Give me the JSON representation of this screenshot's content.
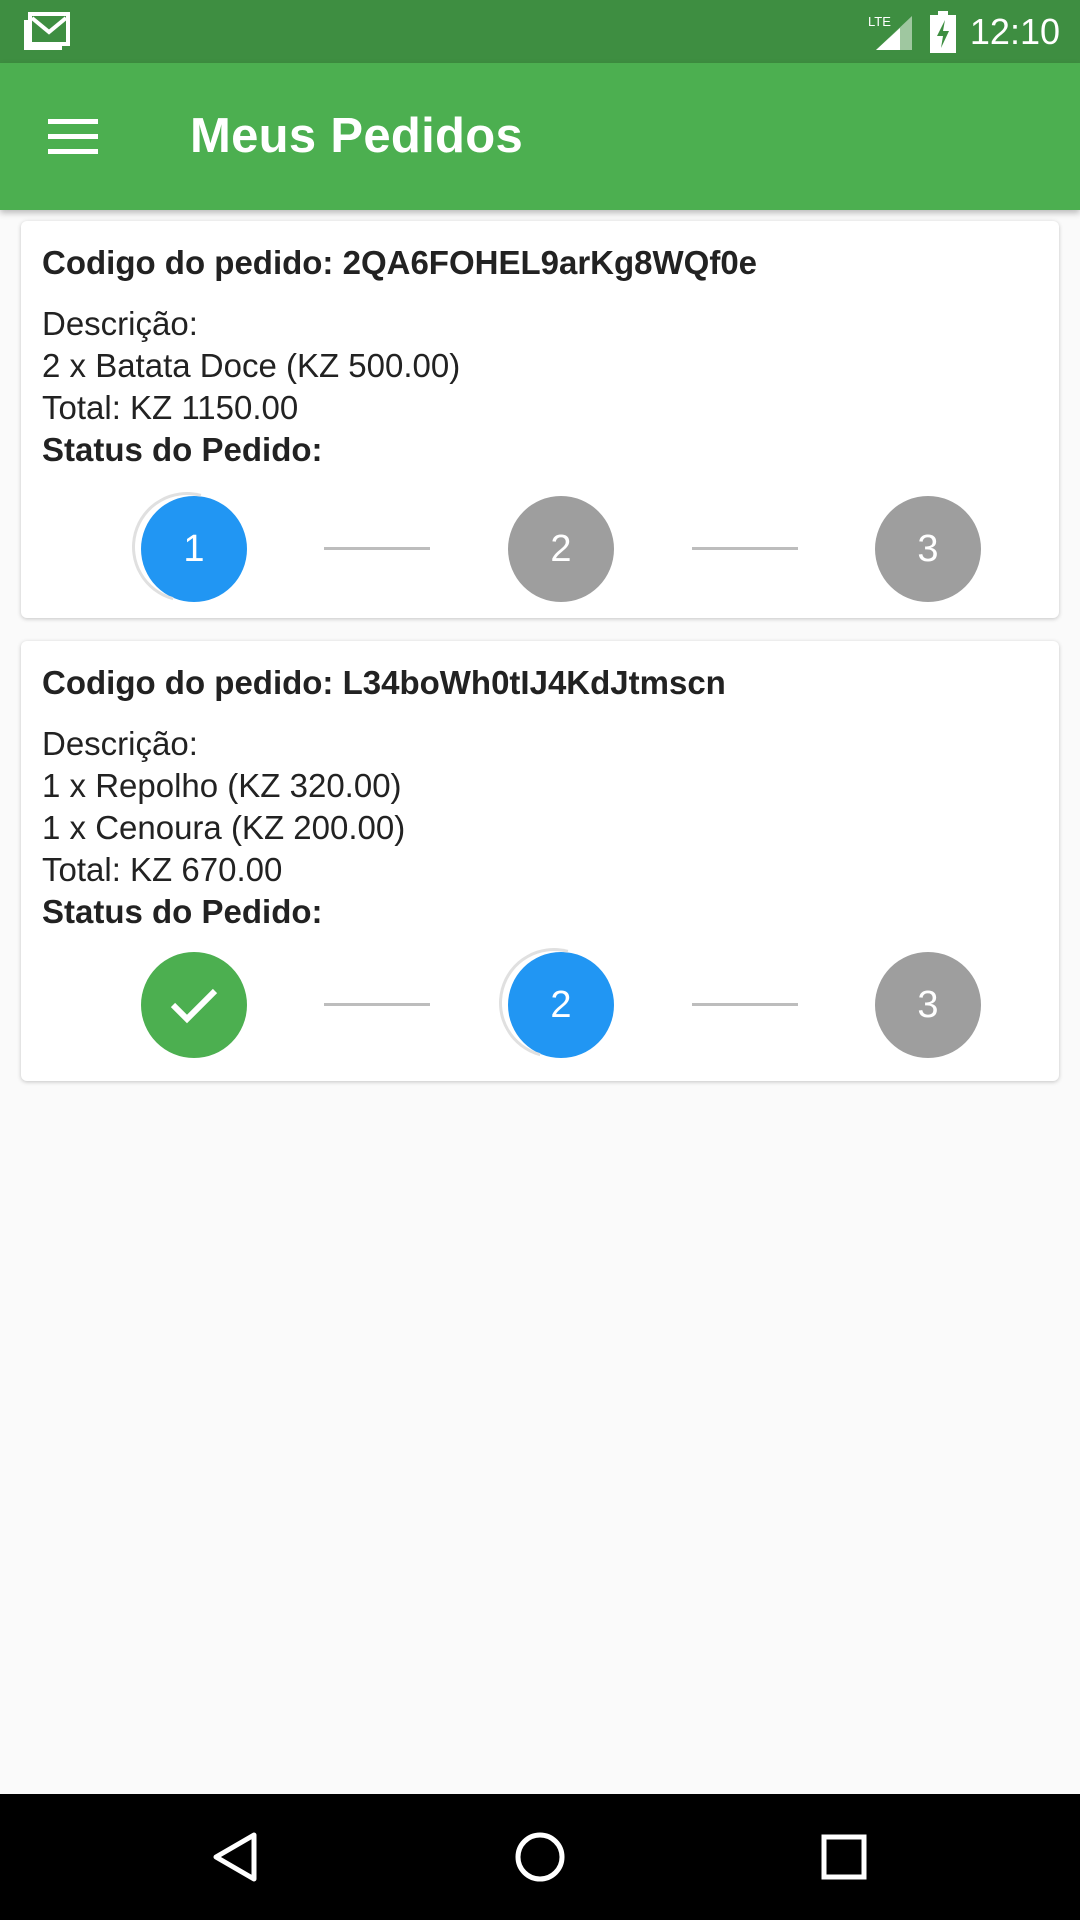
{
  "status_bar": {
    "time": "12:10",
    "network": "LTE",
    "icons": [
      "gmail-icon",
      "signal-icon",
      "battery-charging-icon"
    ]
  },
  "app_bar": {
    "title": "Meus Pedidos",
    "menu_icon": "menu-icon"
  },
  "orders": [
    {
      "code_label": "Codigo do pedido: 2QA6FOHEL9arKg8WQf0e",
      "description_label": "Descrição:",
      "items": [
        "2 x Batata Doce (KZ 500.00)"
      ],
      "total": "Total: KZ 1150.00",
      "status_label": "Status do Pedido:",
      "steps": [
        {
          "label": "1",
          "state": "active"
        },
        {
          "label": "2",
          "state": "pending"
        },
        {
          "label": "3",
          "state": "pending"
        }
      ]
    },
    {
      "code_label": "Codigo do pedido: L34boWh0tIJ4KdJtmscn",
      "description_label": "Descrição:",
      "items": [
        "1 x Repolho (KZ 320.00)",
        "1 x Cenoura (KZ 200.00)"
      ],
      "total": "Total: KZ 670.00",
      "status_label": "Status do Pedido:",
      "steps": [
        {
          "label": "",
          "state": "done"
        },
        {
          "label": "2",
          "state": "active"
        },
        {
          "label": "3",
          "state": "pending"
        }
      ]
    }
  ],
  "colors": {
    "status_bar": "#3e8e41",
    "app_bar": "#4caf50",
    "step_active": "#2196f3",
    "step_pending": "#9e9e9e",
    "step_done": "#4caf50"
  },
  "nav_bar": {
    "buttons": [
      "back-icon",
      "home-icon",
      "recents-icon"
    ]
  }
}
